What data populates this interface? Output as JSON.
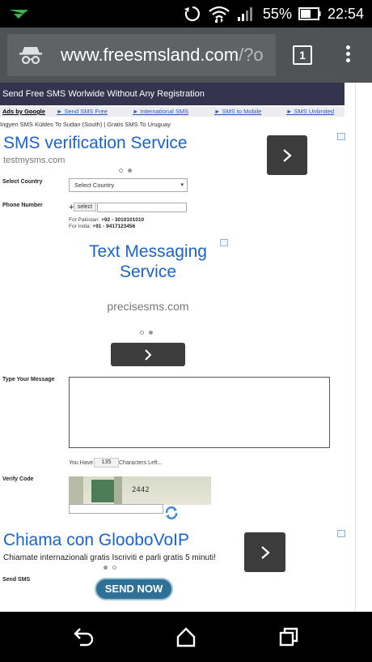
{
  "status_bar": {
    "battery_percent": "55%",
    "time": "22:54"
  },
  "browser": {
    "url_host": "www.freesmsland.com",
    "url_rest": "/?o",
    "tab_count": "1"
  },
  "site": {
    "header_title": "Send Free SMS Worlwide Without Any Registration",
    "ads_by": "Ads by Google",
    "ad_links": [
      "► Send SMS Free",
      "► International SMS",
      "► SMS to Mobile",
      "► SMS Unlimited"
    ],
    "ticker": "Ingyen SMS Küldes To Sudan (South) | Gratis SMS To Uruguay"
  },
  "ad1": {
    "title": "SMS verification Service",
    "url": "testmysms.com"
  },
  "form": {
    "country_label": "Select Country",
    "country_selected": "Select Country",
    "phone_label": "Phone Number",
    "phone_prefix": "+",
    "code_button": "select",
    "hint_pk_label": "For Pakistan:",
    "hint_pk_value": "+92 - 3010101010",
    "hint_in_label": "For India:",
    "hint_in_value": "+91 - 9417123456",
    "message_label": "Type Your Message",
    "chars_prefix": "You Have",
    "chars_count": "135",
    "chars_suffix": "Characters Left...",
    "verify_label": "Verify Code",
    "captcha_text": "2442",
    "send_label": "Send SMS",
    "send_button": "SEND NOW"
  },
  "ad2": {
    "title_line1": "Text Messaging",
    "title_line2": "Service",
    "url": "precisesms.com"
  },
  "ad3": {
    "title": "Chiama con GlooboVoIP",
    "text": "Chiamate internazionali gratis Iscriviti e parli gratis 5 minuti!"
  },
  "colors": {
    "ad_link_blue": "#1a64c8",
    "header_bg": "#34344e",
    "send_button": "#2f7096",
    "toolbar": "#505356"
  },
  "icons": [
    "incognito-icon",
    "rotate-icon",
    "wifi-icon",
    "signal-icon",
    "battery-icon",
    "tab-switcher-icon",
    "overflow-menu-icon",
    "chevron-right-icon",
    "adchoices-icon",
    "refresh-icon",
    "back-icon",
    "home-icon",
    "recents-icon"
  ]
}
